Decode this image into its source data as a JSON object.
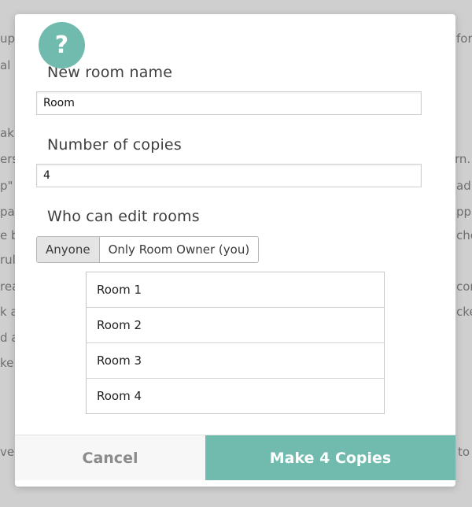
{
  "background": {
    "fragments": [
      {
        "id": "l1",
        "text": "up"
      },
      {
        "id": "l2",
        "text": "al ,"
      },
      {
        "id": "l3",
        "text": "ak"
      },
      {
        "id": "l4",
        "text": "ers"
      },
      {
        "id": "l5",
        "text": "p\""
      },
      {
        "id": "l6",
        "text": "pa"
      },
      {
        "id": "l7",
        "text": "e b"
      },
      {
        "id": "l8",
        "text": "rul"
      },
      {
        "id": "l9",
        "text": "rea"
      },
      {
        "id": "l10",
        "text": "k a"
      },
      {
        "id": "l11",
        "text": "d a"
      },
      {
        "id": "l12",
        "text": "ke"
      },
      {
        "id": "l13",
        "text": "ves"
      },
      {
        "id": "r1",
        "text": "for"
      },
      {
        "id": "r2",
        "text": "rn."
      },
      {
        "id": "r3",
        "text": "ad"
      },
      {
        "id": "r4",
        "text": "pp"
      },
      {
        "id": "r5",
        "text": "che"
      },
      {
        "id": "r6",
        "text": "con"
      },
      {
        "id": "r7",
        "text": "cke"
      },
      {
        "id": "r8",
        "text": "to"
      }
    ]
  },
  "modal": {
    "help_icon": "question-mark-icon",
    "help_glyph": "?",
    "room_name": {
      "label": "New room name",
      "value": "Room"
    },
    "copies": {
      "label": "Number of copies",
      "value": "4"
    },
    "edit_access": {
      "label": "Who can edit rooms",
      "options": [
        "Anyone",
        "Only Room Owner (you)"
      ],
      "selected": "Anyone"
    },
    "rooms": [
      "Room 1",
      "Room 2",
      "Room 3",
      "Room 4"
    ],
    "footer": {
      "cancel_label": "Cancel",
      "primary_label": "Make 4 Copies"
    }
  },
  "colors": {
    "accent": "#70bbae",
    "cancel_text": "#8b8b8b",
    "backdrop": "#cfcfcf"
  }
}
